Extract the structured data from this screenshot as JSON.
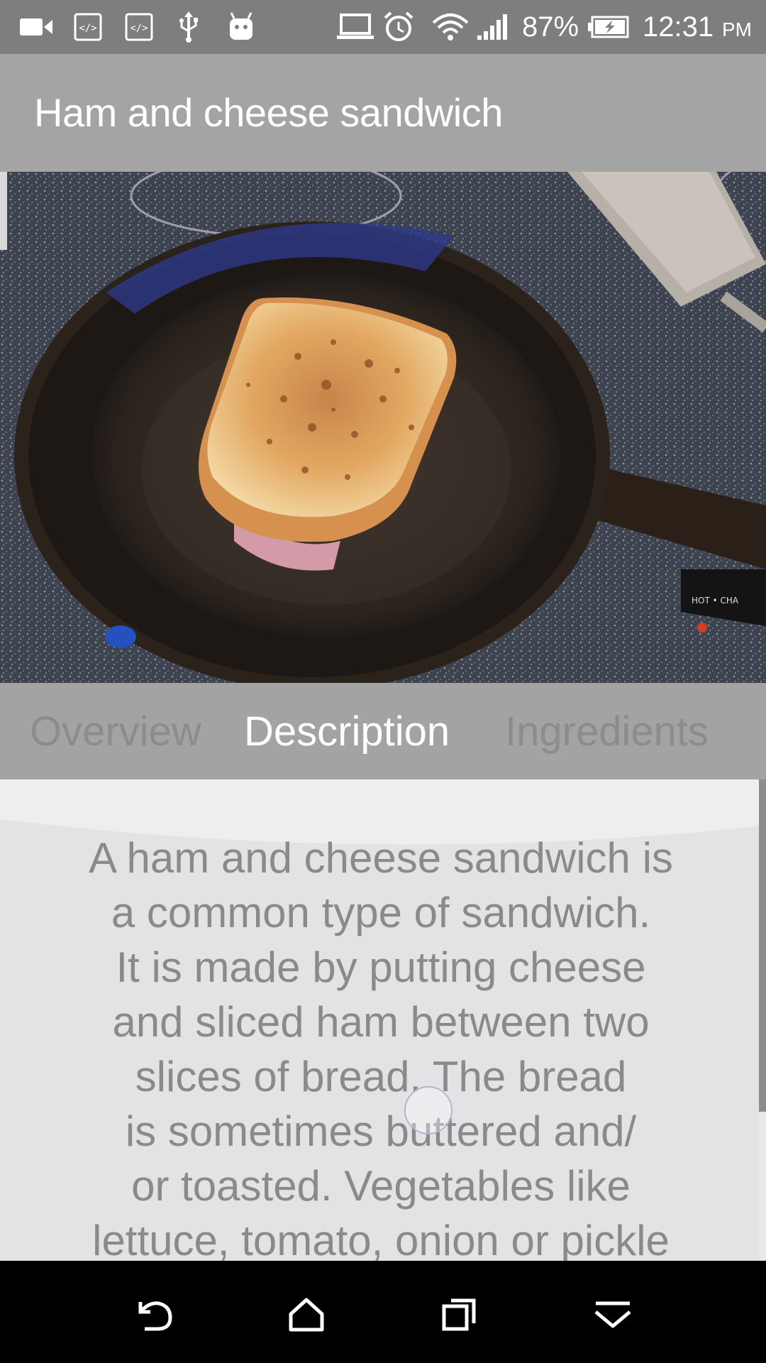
{
  "status_bar": {
    "battery_percent": "87%",
    "time": "12:31",
    "time_suffix": "PM",
    "icons": [
      "video-camera-icon",
      "code-icon",
      "code-icon",
      "usb-icon",
      "android-debug-icon",
      "laptop-icon",
      "alarm-icon",
      "wifi-icon",
      "signal-icon",
      "battery-charging-icon"
    ]
  },
  "app_bar": {
    "title": "Ham and cheese sandwich"
  },
  "photo": {
    "subject": "toasted-ham-and-cheese-sandwich-in-cast-iron-skillet"
  },
  "tabs": [
    {
      "label": "Overview",
      "selected": false
    },
    {
      "label": "Description",
      "selected": true
    },
    {
      "label": "Ingredients",
      "selected": false
    }
  ],
  "description": {
    "lines": [
      "A ham and cheese sandwich is",
      "a common type of sandwich.",
      "It is made by putting cheese",
      "and sliced ham between two",
      "slices of bread. The bread",
      "is sometimes buttered and/",
      "or toasted. Vegetables like",
      "lettuce, tomato, onion or pickle"
    ]
  },
  "nav_bar": {
    "icons": [
      "back-icon",
      "home-icon",
      "recents-icon",
      "collapse-icon"
    ]
  },
  "colors": {
    "status_bar": "#7e7e7e",
    "app_bar": "#a4a4a4",
    "tabs_bar": "#a3a3a3",
    "content_bg": "#e3e3e6",
    "nav_bar": "#000000"
  }
}
